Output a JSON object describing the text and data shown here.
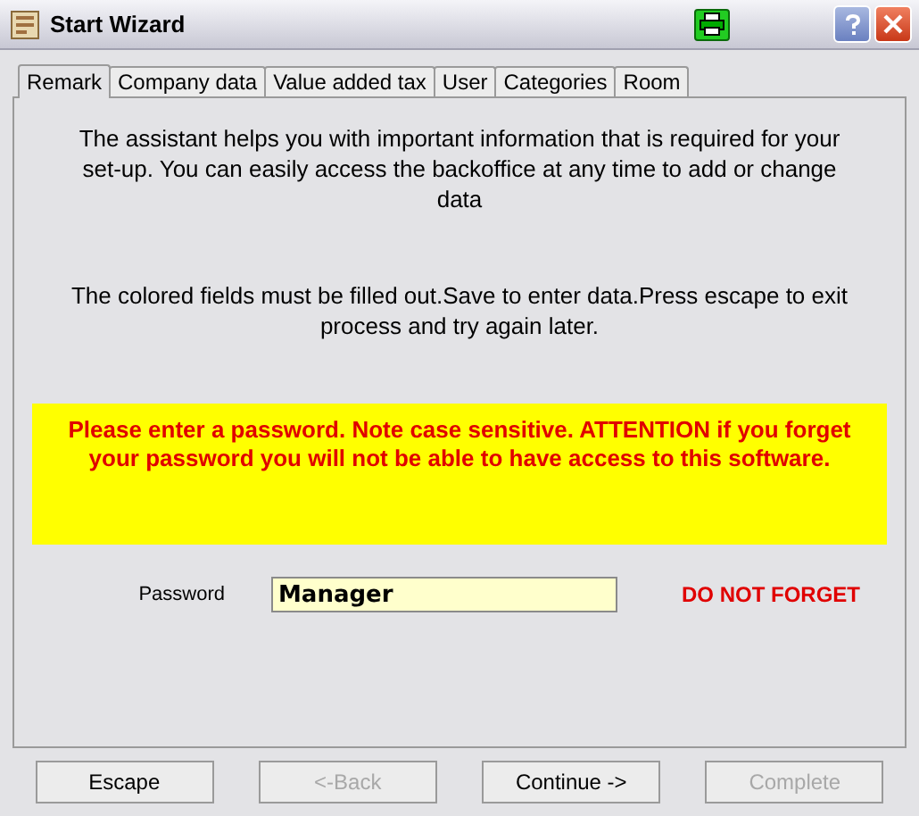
{
  "window": {
    "title": "Start Wizard"
  },
  "tabs": [
    {
      "label": "Remark",
      "selected": true
    },
    {
      "label": "Company data",
      "selected": false
    },
    {
      "label": "Value added tax",
      "selected": false
    },
    {
      "label": "User",
      "selected": false
    },
    {
      "label": "Categories",
      "selected": false
    },
    {
      "label": "Room",
      "selected": false
    }
  ],
  "intro": "The assistant helps you with important information that is required for your set-up. You can easily access the backoffice at any time to add or change data",
  "instructions": "The colored fields must be filled out.Save to enter data.Press escape to exit process and try again later.",
  "warning": "Please enter a password. Note case sensitive. ATTENTION if you forget your password you will not be able to have access to this software.",
  "password": {
    "label": "Password",
    "value": "Manager",
    "note": "DO NOT FORGET"
  },
  "buttons": [
    {
      "label": "Escape",
      "disabled": false
    },
    {
      "label": "<-Back",
      "disabled": true
    },
    {
      "label": "Continue ->",
      "disabled": false
    },
    {
      "label": "Complete",
      "disabled": true
    }
  ]
}
